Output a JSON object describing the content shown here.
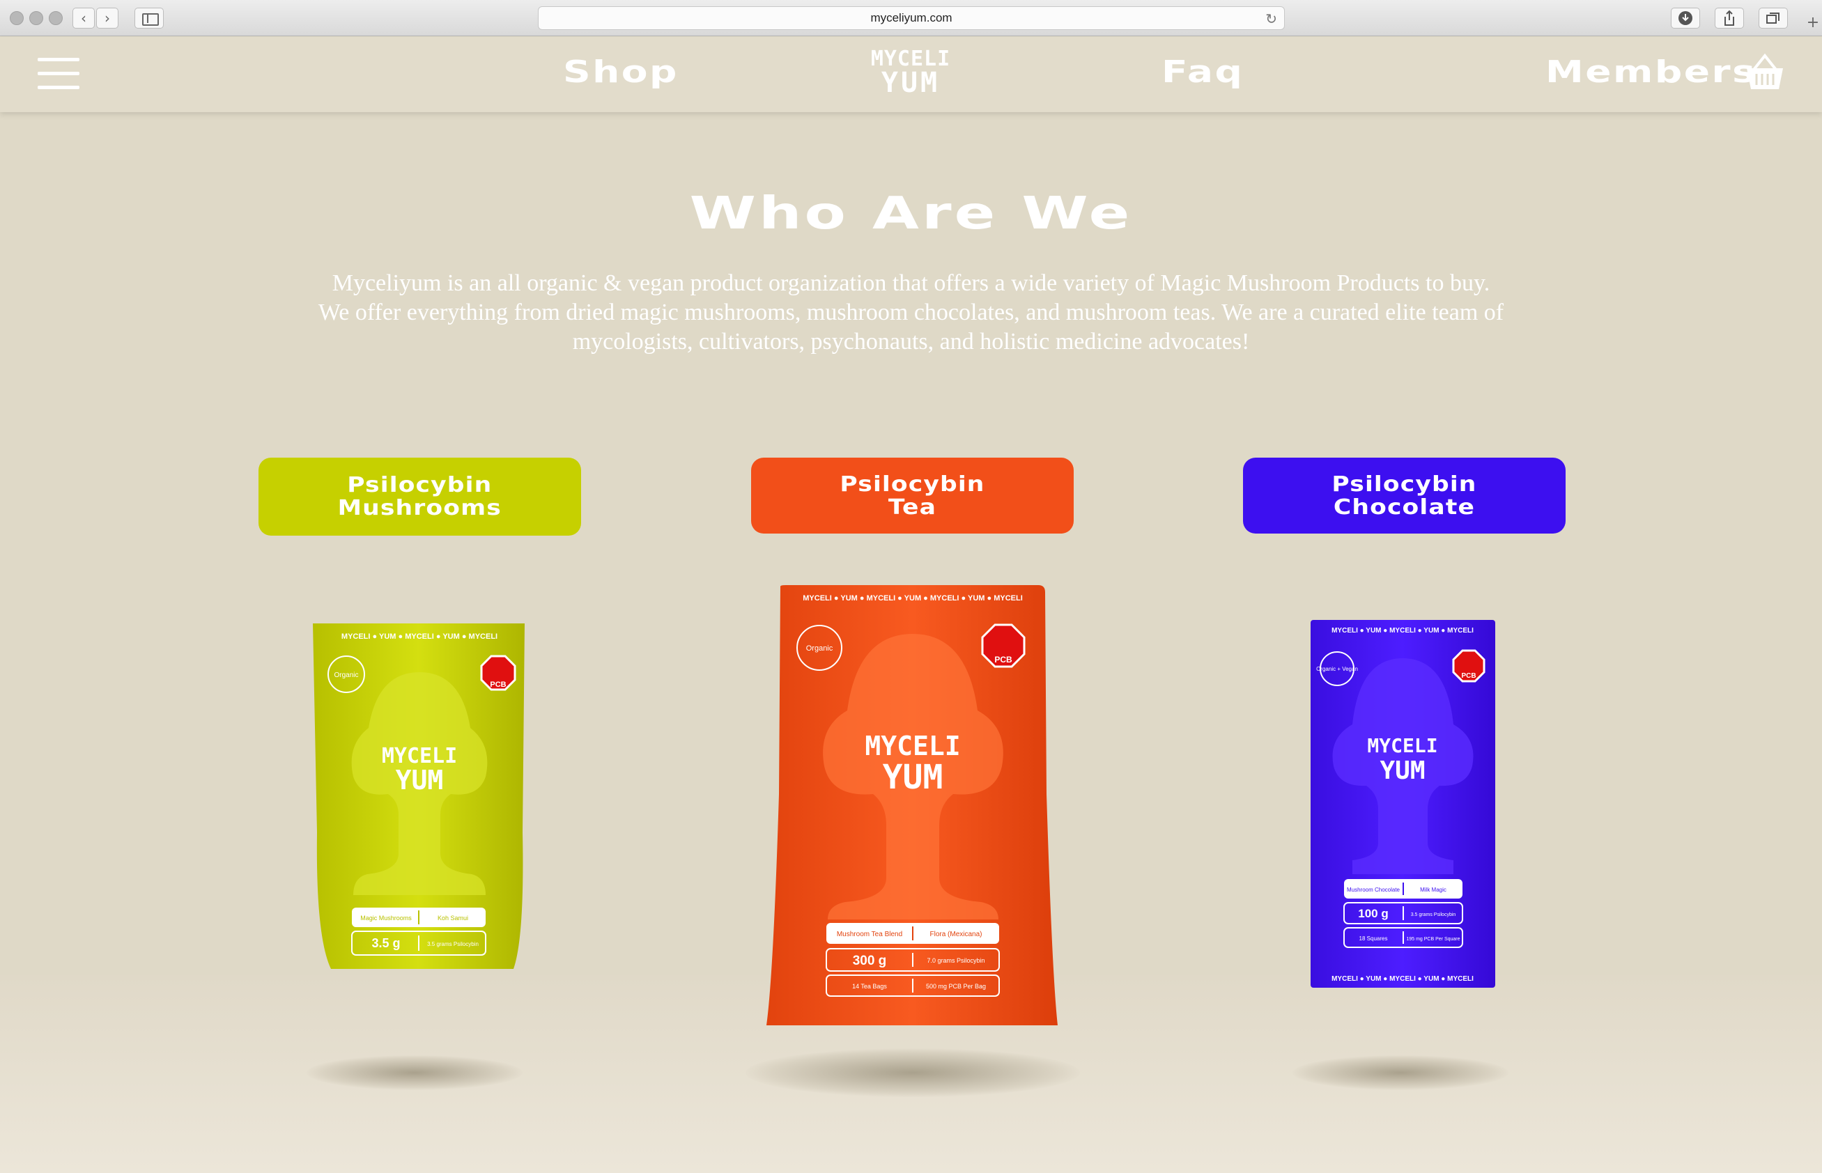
{
  "browser": {
    "url": "myceliyum.com",
    "icons": {
      "reload": "reload-icon",
      "download": "download-icon",
      "share": "share-icon",
      "tabs": "tabs-icon",
      "new_tab": "plus-icon"
    }
  },
  "header": {
    "nav": {
      "shop": "Shop",
      "faq": "Faq",
      "members": "Members"
    },
    "logo": {
      "line1": "MYCELI",
      "line2": "YUM"
    },
    "icons": {
      "menu": "hamburger-menu-icon",
      "cart": "basket-icon"
    }
  },
  "hero": {
    "title": "Who Are We",
    "line1": "Myceliyum is an all organic & vegan product organization that offers a wide variety of Magic Mushroom Products to buy.",
    "line2": "We offer everything from dried magic mushrooms, mushroom chocolates, and mushroom teas. We are a curated elite team of",
    "line3": "mycologists, cultivators, psychonauts, and holistic medicine advocates!"
  },
  "products": [
    {
      "category": "Psilocybin\nMushrooms",
      "color": "#c6d000",
      "band": "MYCELI ● YUM ● MYCELI ● YUM ● MYCELI",
      "badge": "Organic",
      "seal": "PCB",
      "logo1": "MYCELI",
      "logo2": "YUM",
      "label_left": "Magic Mushrooms",
      "label_right": "Koh Samui",
      "weight": "3.5 g",
      "detail": "3.5 grams Psilocybin"
    },
    {
      "category": "Psilocybin\nTea",
      "color": "#f24f19",
      "band": "MYCELI ● YUM ● MYCELI ● YUM ● MYCELI ● YUM ● MYCELI",
      "badge": "Organic",
      "seal": "PCB",
      "logo1": "MYCELI",
      "logo2": "YUM",
      "label_left": "Mushroom Tea Blend",
      "label_right": "Flora (Mexicana)",
      "weight": "300 g",
      "detail": "7.0 grams Psilocybin",
      "extra_left": "14 Tea Bags",
      "extra_right": "500 mg PCB Per Bag"
    },
    {
      "category": "Psilocybin\nChocolate",
      "color": "#3d0ff0",
      "band": "MYCELI ● YUM ● MYCELI ● YUM ● MYCELI",
      "badge": "Organic + Vegan",
      "seal": "PCB",
      "logo1": "MYCELI",
      "logo2": "YUM",
      "label_left": "Mushroom Chocolate",
      "label_right": "Milk Magic",
      "weight": "100 g",
      "detail": "3.5 grams Psilocybin",
      "extra_left": "18 Squares",
      "extra_right": "195 mg PCB Per Square"
    }
  ]
}
